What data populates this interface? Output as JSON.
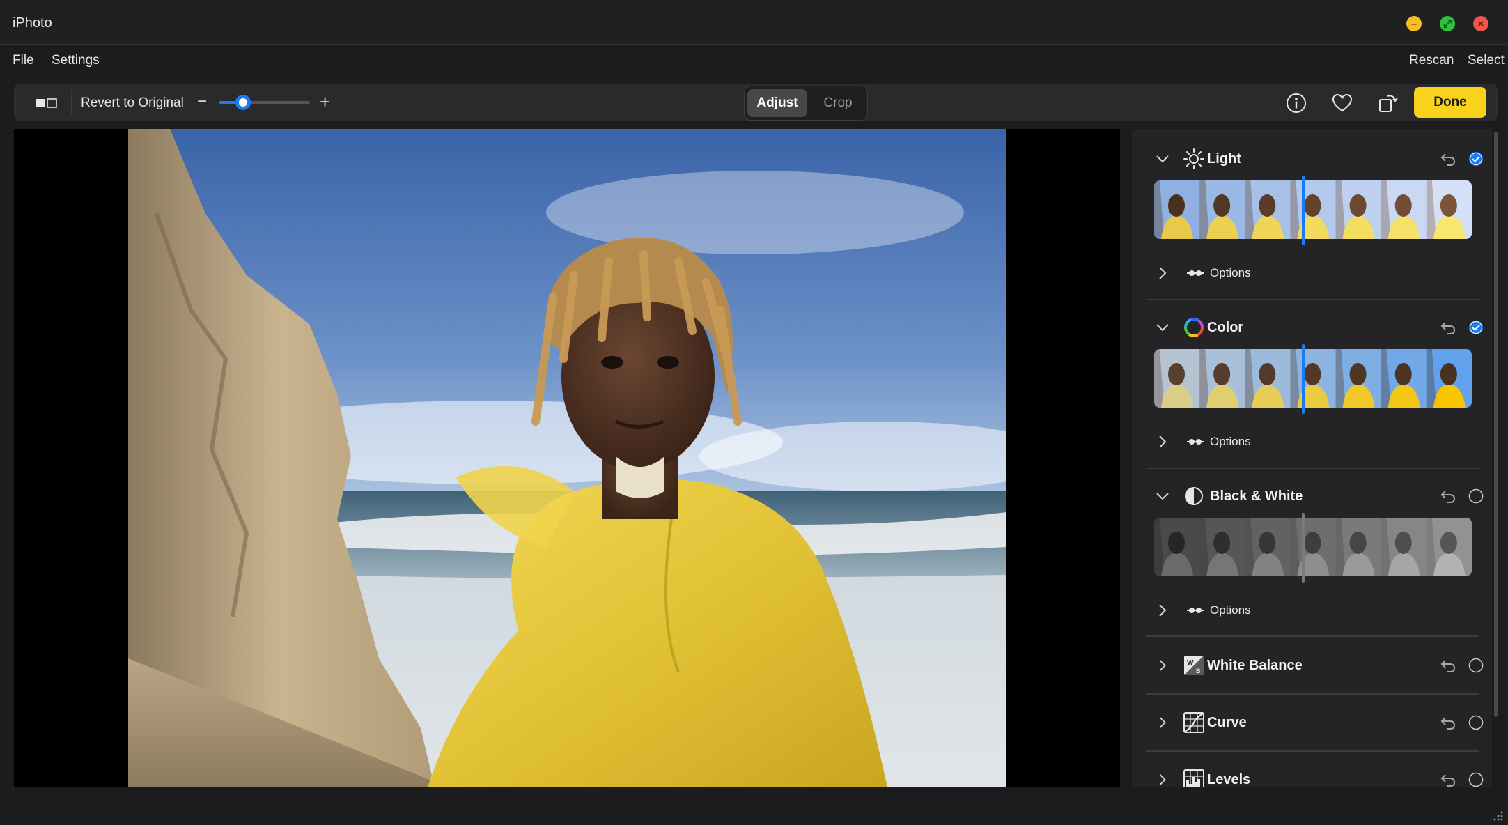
{
  "window": {
    "title": "iPhoto"
  },
  "menu": {
    "left": [
      "File",
      "Settings"
    ],
    "right": [
      "Rescan",
      "Select"
    ]
  },
  "toolbar": {
    "revert_label": "Revert to Original",
    "zoom_minus": "−",
    "zoom_plus": "+",
    "zoom_level": 0.26,
    "segments": [
      "Adjust",
      "Crop"
    ],
    "active_segment": "Adjust",
    "done_label": "Done",
    "accent_color": "#1a7cf5",
    "done_color": "#f8d21b"
  },
  "photo": {
    "description_icon": "portrait-photo"
  },
  "panel": {
    "sections": [
      {
        "id": "light",
        "title": "Light",
        "icon": "sun-icon",
        "expanded": true,
        "enabled": true,
        "options_label": "Options",
        "strip": "color"
      },
      {
        "id": "color",
        "title": "Color",
        "icon": "color-wheel-icon",
        "expanded": true,
        "enabled": true,
        "options_label": "Options",
        "strip": "saturated"
      },
      {
        "id": "bw",
        "title": "Black & White",
        "icon": "half-circle-icon",
        "expanded": true,
        "enabled": false,
        "options_label": "Options",
        "strip": "mono"
      },
      {
        "id": "wb",
        "title": "White Balance",
        "icon": "white-balance-icon",
        "expanded": false,
        "enabled": false
      },
      {
        "id": "curve",
        "title": "Curve",
        "icon": "curve-icon",
        "expanded": false,
        "enabled": false
      },
      {
        "id": "levels",
        "title": "Levels",
        "icon": "levels-icon",
        "expanded": false,
        "enabled": false
      }
    ]
  }
}
